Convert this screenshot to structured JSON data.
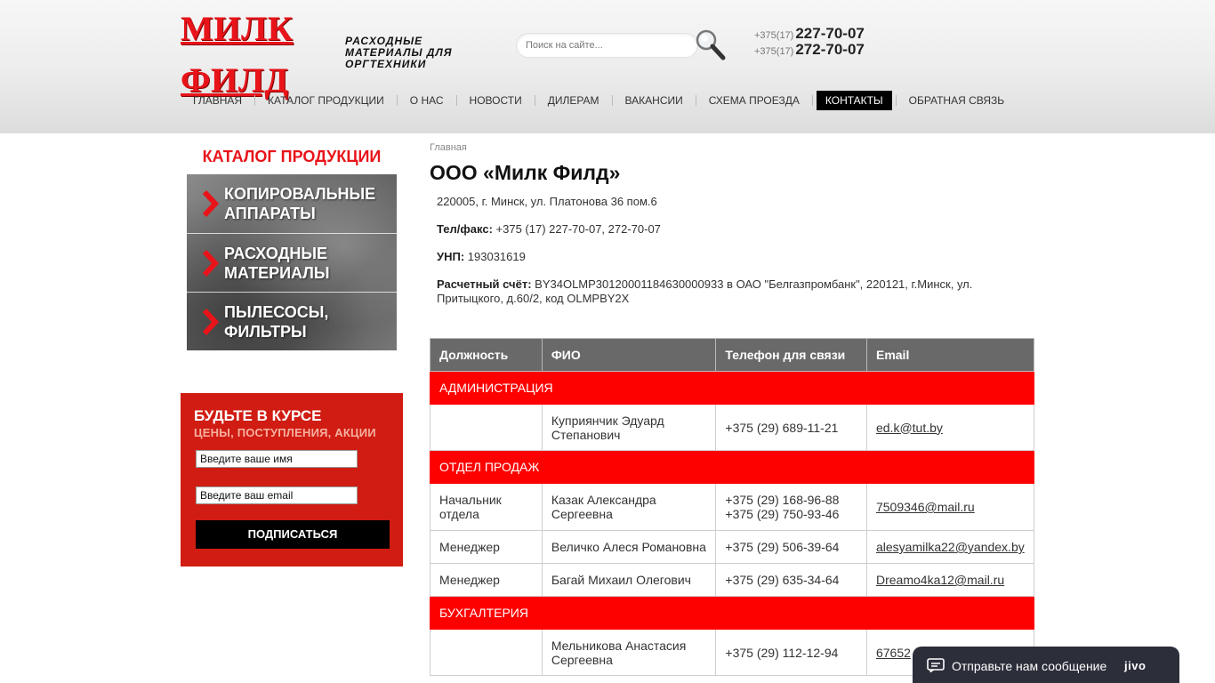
{
  "header": {
    "logo_line1": "МИЛК",
    "logo_line2": "ФИЛД",
    "tagline": "РАСХОДНЫЕ МАТЕРИАЛЫ ДЛЯ ОРГТЕХНИКИ",
    "search_placeholder": "Поиск на сайте...",
    "phones": [
      {
        "code": "+375(17)",
        "number": "227-70-07"
      },
      {
        "code": "+375(17)",
        "number": "272-70-07"
      }
    ]
  },
  "nav": [
    {
      "label": "ГЛАВНАЯ"
    },
    {
      "label": "КАТАЛОГ ПРОДУКЦИИ"
    },
    {
      "label": "О НАС"
    },
    {
      "label": "НОВОСТИ"
    },
    {
      "label": "ДИЛЕРАМ"
    },
    {
      "label": "ВАКАНСИИ"
    },
    {
      "label": "СХЕМА ПРОЕЗДА"
    },
    {
      "label": "КОНТАКТЫ",
      "active": true
    },
    {
      "label": "ОБРАТНАЯ СВЯЗЬ"
    }
  ],
  "sidebar": {
    "catalog_title": "КАТАЛОГ ПРОДУКЦИИ",
    "catalog_items": [
      {
        "label": "КОПИРОВАЛЬНЫЕ АППАРАТЫ"
      },
      {
        "label": "РАСХОДНЫЕ МАТЕРИАЛЫ"
      },
      {
        "label": "ПЫЛЕСОСЫ, ФИЛЬТРЫ"
      }
    ],
    "subscribe": {
      "title": "БУДЬТЕ В КУРСЕ",
      "subtitle": "ЦЕНЫ, ПОСТУПЛЕНИЯ, АКЦИИ",
      "name_placeholder": "Введите ваше имя",
      "email_placeholder": "Введите ваш email",
      "button": "ПОДПИСАТЬСЯ"
    }
  },
  "main": {
    "breadcrumb": "Главная",
    "title": "ООО «Милк Филд»",
    "address": "220005, г. Минск, ул. Платонова 36 пом.6",
    "phone_label": "Тел/факс:",
    "phone_value": "+375 (17) 227-70-07, 272-70-07",
    "unp_label": "УНП:",
    "unp_value": "193031619",
    "account_label": "Расчетный счёт:",
    "account_value": "BY34OLMP30120001184630000933 в ОАО \"Белгазпромбанк\", 220121, г.Минск, ул. Притыцкого, д.60/2, код OLMPBY2X"
  },
  "table": {
    "headers": [
      "Должность",
      "ФИО",
      "Телефон для связи",
      "Email"
    ],
    "sections": [
      {
        "title": "АДМИНИСТРАЦИЯ",
        "rows": [
          {
            "position": "",
            "name": "Куприянчик Эдуард Степанович",
            "phone": "+375 (29) 689-11-21",
            "email": "ed.k@tut.by"
          }
        ]
      },
      {
        "title": "ОТДЕЛ ПРОДАЖ",
        "rows": [
          {
            "position": "Начальник отдела",
            "name": "Казак Александра Сергеевна",
            "phone": "+375 (29) 168-96-88\n+375 (29) 750-93-46",
            "email": "7509346@mail.ru"
          },
          {
            "position": "Менеджер",
            "name": "Величко Алеся Романовна",
            "phone": "+375 (29) 506-39-64",
            "email": "alesyamilka22@yandex.by"
          },
          {
            "position": "Менеджер",
            "name": "Багай Михаил Олегович",
            "phone": "+375 (29) 635-34-64",
            "email": "Dreamo4ka12@mail.ru"
          }
        ]
      },
      {
        "title": "БУХГАЛТЕРИЯ",
        "rows": [
          {
            "position": "",
            "name": "Мельникова Анастасия Сергеевна",
            "phone": "+375 (29) 112-12-94",
            "email": "67652"
          }
        ]
      }
    ]
  },
  "chat": {
    "text": "Отправьте нам сообщение",
    "brand": "jivo"
  }
}
